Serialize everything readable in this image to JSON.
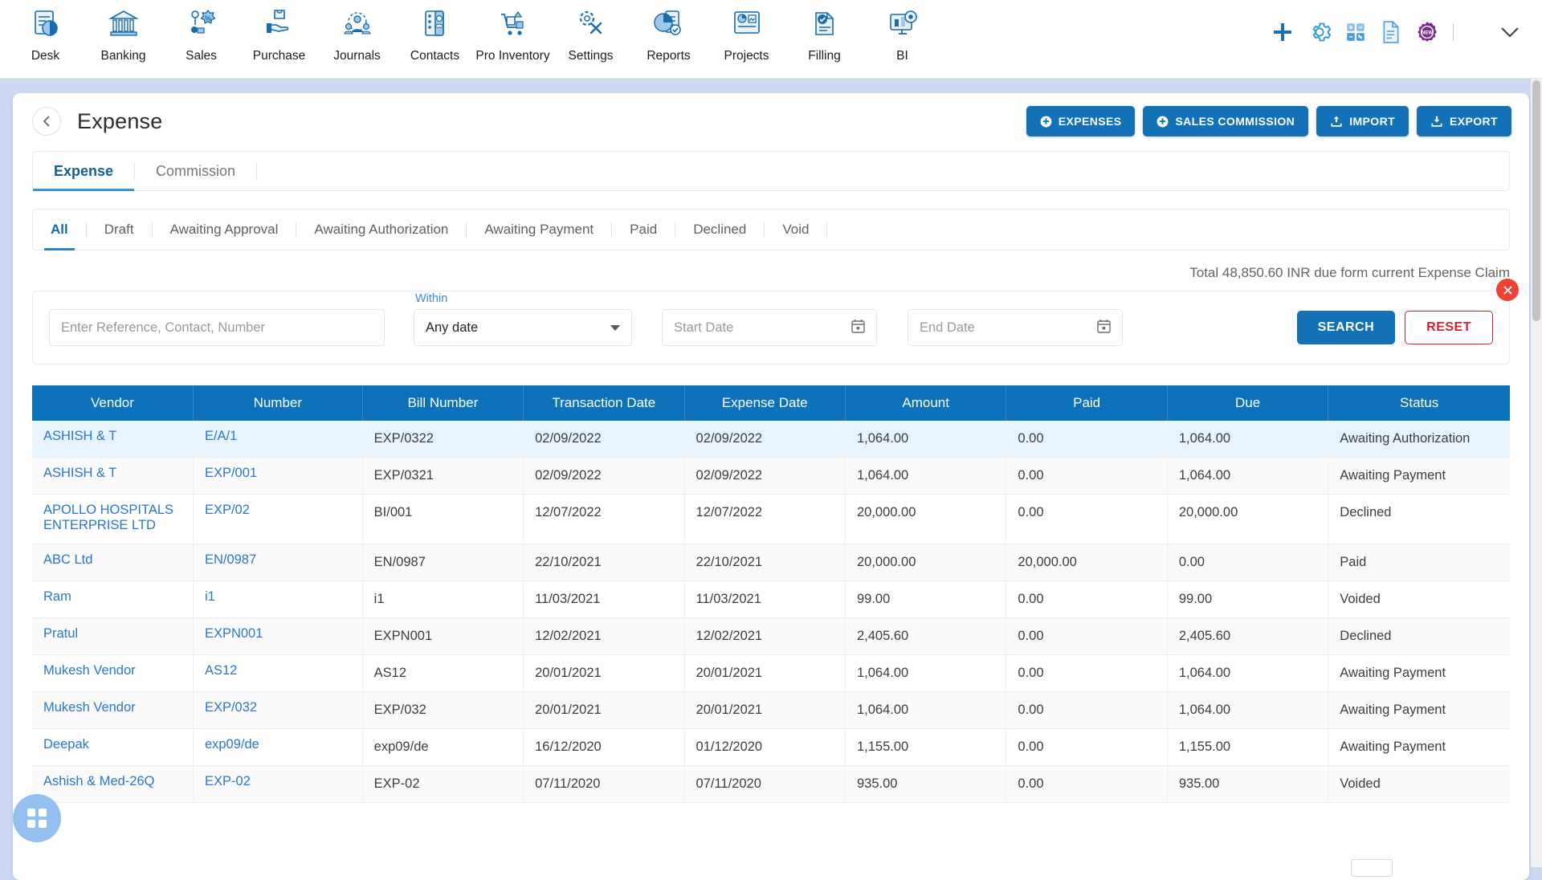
{
  "topnav": {
    "items": [
      {
        "label": "Desk",
        "icon": "dashboard-icon"
      },
      {
        "label": "Banking",
        "icon": "bank-icon"
      },
      {
        "label": "Sales",
        "icon": "sales-icon"
      },
      {
        "label": "Purchase",
        "icon": "purchase-icon"
      },
      {
        "label": "Journals",
        "icon": "journals-icon"
      },
      {
        "label": "Contacts",
        "icon": "contacts-icon"
      },
      {
        "label": "Pro Inventory",
        "icon": "inventory-icon"
      },
      {
        "label": "Settings",
        "icon": "settings-tools-icon"
      },
      {
        "label": "Reports",
        "icon": "reports-icon"
      },
      {
        "label": "Projects",
        "icon": "projects-icon"
      },
      {
        "label": "Filling",
        "icon": "filling-icon"
      },
      {
        "label": "BI",
        "icon": "bi-icon"
      }
    ],
    "actions": [
      {
        "icon": "plus-icon",
        "color": "#1a6fb5"
      },
      {
        "icon": "gear-icon",
        "color": "#2e9ad0"
      },
      {
        "icon": "calculator-icon",
        "color": "#4a9ede"
      },
      {
        "icon": "document-icon",
        "color": "#4a9ede"
      },
      {
        "icon": "new-badge-icon",
        "color": "#7b2d8e"
      }
    ],
    "chevron": "chevron-down-icon"
  },
  "header": {
    "back_icon": "chevron-left-icon",
    "title": "Expense",
    "buttons": [
      {
        "label": "EXPENSES",
        "icon": "plus-circle-icon"
      },
      {
        "label": "SALES COMMISSION",
        "icon": "plus-circle-icon"
      },
      {
        "label": "IMPORT",
        "icon": "upload-icon"
      },
      {
        "label": "EXPORT",
        "icon": "download-icon"
      }
    ]
  },
  "subtabs": {
    "items": [
      "Expense",
      "Commission"
    ],
    "active": "Expense"
  },
  "statustabs": {
    "items": [
      "All",
      "Draft",
      "Awaiting Approval",
      "Awaiting Authorization",
      "Awaiting Payment",
      "Paid",
      "Declined",
      "Void"
    ],
    "active": "All"
  },
  "summary": {
    "total_text": "Total 48,850.60 INR due form current Expense Claim"
  },
  "search": {
    "reference_placeholder": "Enter Reference, Contact, Number",
    "within_label": "Within",
    "within_value": "Any date",
    "start_date_placeholder": "Start Date",
    "end_date_placeholder": "End Date",
    "search_label": "SEARCH",
    "reset_label": "RESET",
    "close_icon": "close-icon",
    "calendar_icon": "calendar-icon"
  },
  "table": {
    "columns": [
      "Vendor",
      "Number",
      "Bill Number",
      "Transaction Date",
      "Expense Date",
      "Amount",
      "Paid",
      "Due",
      "Status"
    ],
    "rows": [
      {
        "vendor": "ASHISH & T",
        "number": "E/A/1",
        "bill_number": "EXP/0322",
        "transaction_date": "02/09/2022",
        "expense_date": "02/09/2022",
        "amount": "1,064.00",
        "paid": "0.00",
        "due": "1,064.00",
        "status": "Awaiting Authorization"
      },
      {
        "vendor": "ASHISH & T",
        "number": "EXP/001",
        "bill_number": "EXP/0321",
        "transaction_date": "02/09/2022",
        "expense_date": "02/09/2022",
        "amount": "1,064.00",
        "paid": "0.00",
        "due": "1,064.00",
        "status": "Awaiting Payment"
      },
      {
        "vendor": "APOLLO HOSPITALS ENTERPRISE LTD",
        "number": "EXP/02",
        "bill_number": "BI/001",
        "transaction_date": "12/07/2022",
        "expense_date": "12/07/2022",
        "amount": "20,000.00",
        "paid": "0.00",
        "due": "20,000.00",
        "status": "Declined"
      },
      {
        "vendor": "ABC Ltd",
        "number": "EN/0987",
        "bill_number": "EN/0987",
        "transaction_date": "22/10/2021",
        "expense_date": "22/10/2021",
        "amount": "20,000.00",
        "paid": "20,000.00",
        "due": "0.00",
        "status": "Paid"
      },
      {
        "vendor": "Ram",
        "number": "i1",
        "bill_number": "i1",
        "transaction_date": "11/03/2021",
        "expense_date": "11/03/2021",
        "amount": "99.00",
        "paid": "0.00",
        "due": "99.00",
        "status": "Voided"
      },
      {
        "vendor": "Pratul",
        "number": "EXPN001",
        "bill_number": "EXPN001",
        "transaction_date": "12/02/2021",
        "expense_date": "12/02/2021",
        "amount": "2,405.60",
        "paid": "0.00",
        "due": "2,405.60",
        "status": "Declined"
      },
      {
        "vendor": "Mukesh Vendor",
        "number": "AS12",
        "bill_number": "AS12",
        "transaction_date": "20/01/2021",
        "expense_date": "20/01/2021",
        "amount": "1,064.00",
        "paid": "0.00",
        "due": "1,064.00",
        "status": "Awaiting Payment"
      },
      {
        "vendor": "Mukesh Vendor",
        "number": "EXP/032",
        "bill_number": "EXP/032",
        "transaction_date": "20/01/2021",
        "expense_date": "20/01/2021",
        "amount": "1,064.00",
        "paid": "0.00",
        "due": "1,064.00",
        "status": "Awaiting Payment"
      },
      {
        "vendor": "Deepak",
        "number": "exp09/de",
        "bill_number": "exp09/de",
        "transaction_date": "16/12/2020",
        "expense_date": "01/12/2020",
        "amount": "1,155.00",
        "paid": "0.00",
        "due": "1,155.00",
        "status": "Awaiting Payment"
      },
      {
        "vendor": "Ashish & Med-26Q",
        "number": "EXP-02",
        "bill_number": "EXP-02",
        "transaction_date": "07/11/2020",
        "expense_date": "07/11/2020",
        "amount": "935.00",
        "paid": "0.00",
        "due": "935.00",
        "status": "Voided"
      }
    ]
  },
  "fab": {
    "icon": "grid-widget-icon"
  },
  "colors": {
    "accent_blue": "#1272b5",
    "header_blue": "#0d72b9",
    "link_blue": "#2b77c4",
    "reset_red": "#d32030",
    "page_bg": "#ccd9f0"
  }
}
